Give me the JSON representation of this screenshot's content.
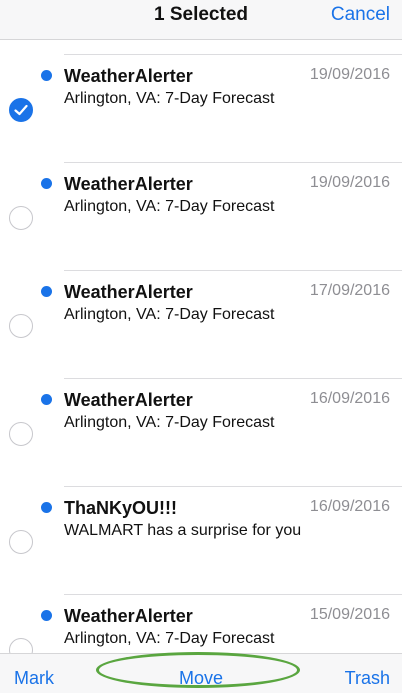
{
  "navbar": {
    "title": "1 Selected",
    "cancel_label": "Cancel"
  },
  "messages": [
    {
      "sender": "WeatherAlerter",
      "date": "19/09/2016",
      "subject": "Arlington, VA: 7-Day Forecast",
      "unread": true,
      "selected": true
    },
    {
      "sender": "WeatherAlerter",
      "date": "19/09/2016",
      "subject": "Arlington, VA: 7-Day Forecast",
      "unread": true,
      "selected": false
    },
    {
      "sender": "WeatherAlerter",
      "date": "17/09/2016",
      "subject": "Arlington, VA: 7-Day Forecast",
      "unread": true,
      "selected": false
    },
    {
      "sender": "WeatherAlerter",
      "date": "16/09/2016",
      "subject": "Arlington, VA: 7-Day Forecast",
      "unread": true,
      "selected": false
    },
    {
      "sender": "ThaNKyOU!!!",
      "date": "16/09/2016",
      "subject": "WALMART has a surprise for you",
      "unread": true,
      "selected": false
    },
    {
      "sender": "WeatherAlerter",
      "date": "15/09/2016",
      "subject": "Arlington, VA: 7-Day Forecast",
      "unread": true,
      "selected": false
    }
  ],
  "toolbar": {
    "mark_label": "Mark",
    "move_label": "Move",
    "trash_label": "Trash"
  },
  "colors": {
    "accent": "#1a73e8",
    "highlight_oval": "#5aa640"
  },
  "icons": {
    "selected": "checkmark-icon",
    "unread": "unread-dot-icon"
  }
}
